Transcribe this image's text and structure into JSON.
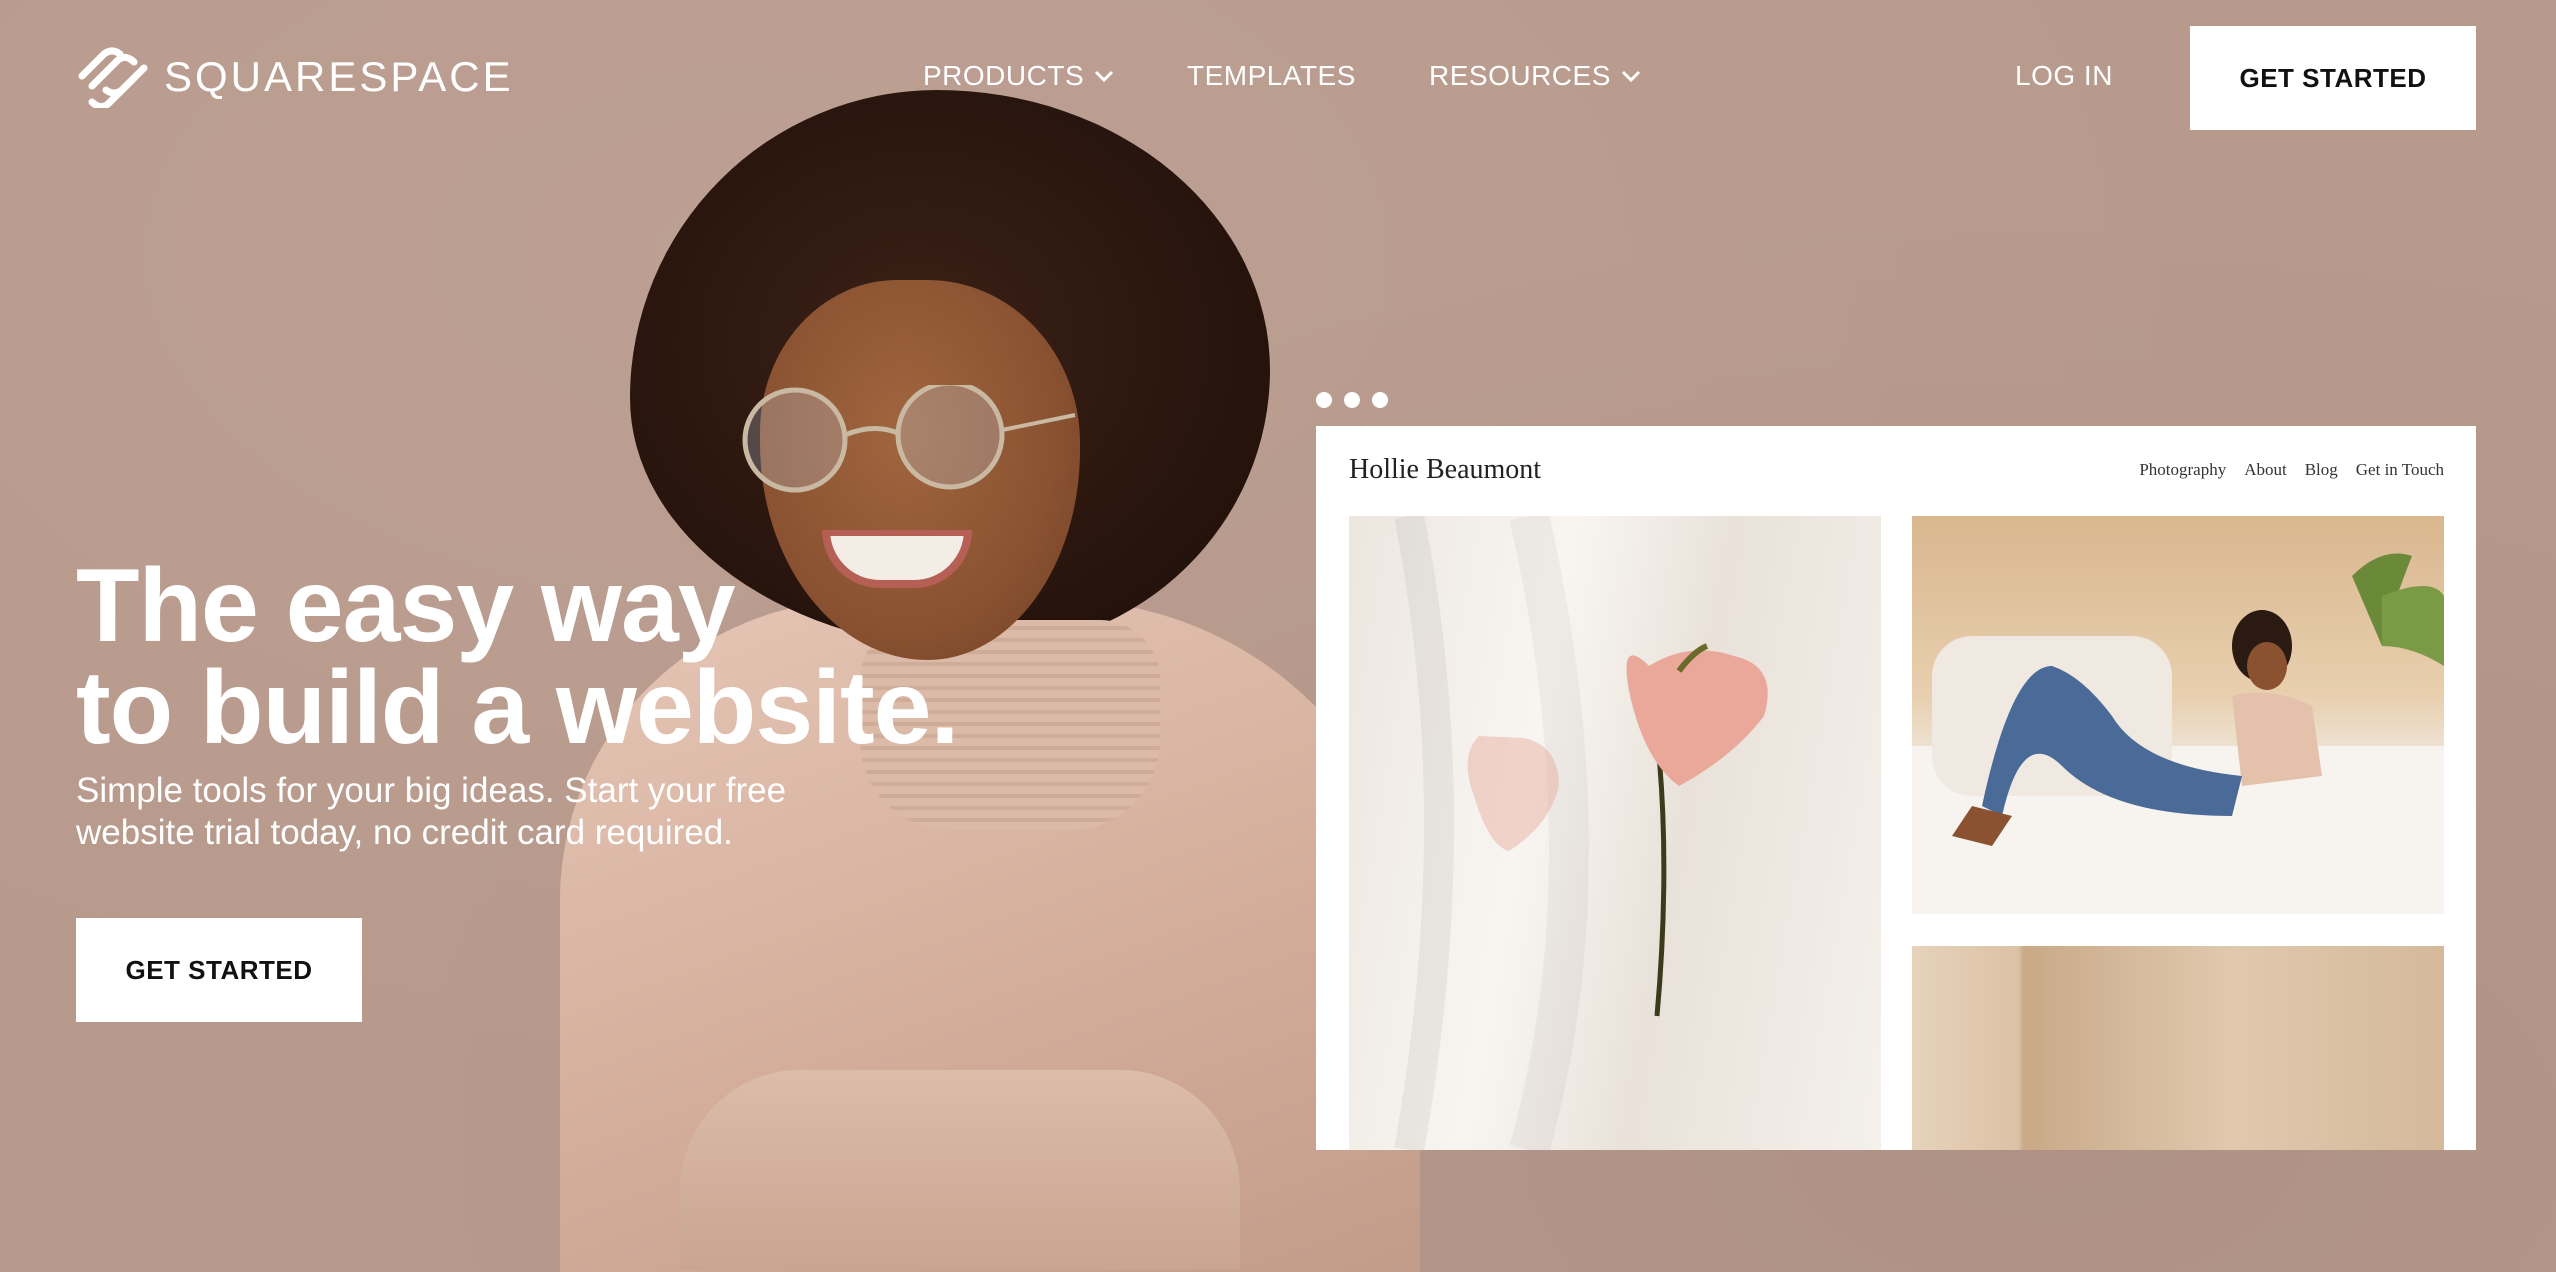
{
  "nav": {
    "brand": "SQUARESPACE",
    "items": [
      {
        "label": "PRODUCTS",
        "dropdown": true
      },
      {
        "label": "TEMPLATES",
        "dropdown": false
      },
      {
        "label": "RESOURCES",
        "dropdown": true
      }
    ],
    "login": "LOG IN",
    "cta": "GET STARTED"
  },
  "hero": {
    "title_line1": "The easy way",
    "title_line2": "to build a website.",
    "subtitle": "Simple tools for your big ideas. Start your free website trial today, no credit card required.",
    "cta": "GET STARTED"
  },
  "mockup": {
    "site_title": "Hollie Beaumont",
    "nav": [
      "Photography",
      "About",
      "Blog",
      "Get in Touch"
    ]
  },
  "colors": {
    "background": "#b89a8c",
    "button_bg": "#ffffff",
    "button_text": "#111111"
  }
}
